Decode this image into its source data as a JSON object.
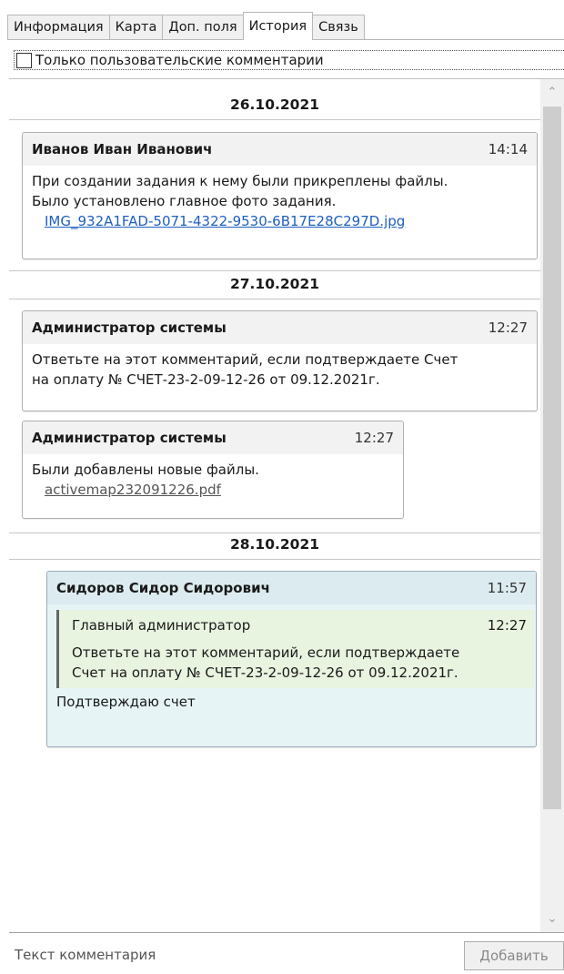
{
  "tabs": [
    {
      "label": "Информация",
      "active": false
    },
    {
      "label": "Карта",
      "active": false
    },
    {
      "label": "Доп. поля",
      "active": false
    },
    {
      "label": "История",
      "active": true
    },
    {
      "label": "Связь",
      "active": false
    }
  ],
  "filter": {
    "label": "Только пользовательские комментарии",
    "checked": false
  },
  "groups": [
    {
      "date": "26.10.2021",
      "entries": [
        {
          "author": "Иванов Иван Иванович",
          "time": "14:14",
          "text": [
            "При создании задания к нему были прикреплены файлы.",
            "Было установлено главное фото задания."
          ],
          "link": "IMG_932A1FAD-5071-4322-9530-6B17E28C297D.jpg"
        }
      ]
    },
    {
      "date": "27.10.2021",
      "entries": [
        {
          "author": "Администратор системы",
          "time": "12:27",
          "text": [
            "Ответьте на этот комментарий, если подтверждаете Счет",
            "на оплату № СЧЕТ-23-2-09-12-26 от 09.12.2021г."
          ]
        },
        {
          "author": "Администратор системы",
          "time": "12:27",
          "text": [
            "Были добавлены новые файлы."
          ],
          "link": "activemap232091226.pdf"
        }
      ]
    },
    {
      "date": "28.10.2021",
      "entries": [
        {
          "author": "Сидоров Сидор Сидорович",
          "time": "11:57",
          "quote": {
            "author": "Главный администратор",
            "time": "12:27",
            "text": [
              "Ответьте на этот комментарий, если подтверждаете",
              "Счет на оплату № СЧЕТ-23-2-09-12-26 от 09.12.2021г."
            ]
          },
          "text": [
            "Подтверждаю счет"
          ]
        }
      ]
    }
  ],
  "comment_input": {
    "placeholder": "Текст комментария"
  },
  "add_button": {
    "label": "Добавить"
  }
}
